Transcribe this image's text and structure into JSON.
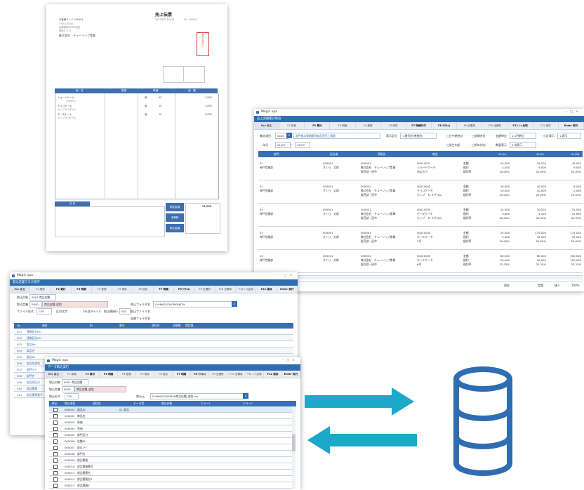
{
  "invoice": {
    "title": "売上伝票",
    "customer_code": "お客様コード 000001",
    "company": "株式会社　チューリップ食事",
    "seal_text": "株式会社チューリップ",
    "table_headers": [
      "品　名",
      "数量",
      "単価",
      "金　額"
    ],
    "lines": [
      {
        "name": "ショートケーキ",
        "sub": "(00001)",
        "qty": "45",
        "unit": "個",
        "amount": "7,000"
      },
      {
        "name": "チョコケーキ",
        "sub": "カップ 6.0グラム",
        "qty": "10",
        "unit": "個",
        "amount": "2,000"
      },
      {
        "name": "チーズケーキ",
        "sub": "カップ 6.0グラム",
        "qty": "10",
        "unit": "個",
        "amount": "2,000"
      }
    ],
    "total_label": "合 計",
    "total_value": "11,000",
    "side_labels": [
      "税抜金額",
      "消費税",
      "税込金額"
    ]
  },
  "detail_window": {
    "window_title": "Magic xpa",
    "app_title": "売上実績集計照会",
    "fkeys": [
      "Esc 戻る",
      "F1 検索",
      "F2 集計",
      "F3 明細",
      "F4 登録",
      "F5 削除",
      "F7 明細行付",
      "F8 ｸﾘｱ(s)",
      "F9 全選択",
      "F10 全解除",
      "F11 ｼｰﾄ反映",
      "F12 保存",
      "Enter 実行"
    ],
    "agg_label": "集計項目",
    "agg_value": "0016",
    "agg_desc": "部門拠点客顧客別商品別売上実績",
    "display_label": "表示区分",
    "display_value": "1:番号別(単独別)",
    "check1": "□日中期合計",
    "check2": "□前期合計",
    "unit_label": "金額単位",
    "unit_value": "1:1円単位",
    "small_label": "小計表示",
    "small_value": "1:表示",
    "period_label": "年月",
    "period_from": "21/04",
    "period_to": "22/03",
    "check3": "□発生内訳",
    "check4": "□前年対比",
    "qty_label": "数量表示",
    "qty_value": "0:非表示",
    "columns": [
      "部門",
      "担当者",
      "得意先",
      "商品",
      "",
      "21/04",
      "21/05",
      "21/06"
    ],
    "rows": [
      {
        "dept": "01",
        "dept2": "神戸営業部",
        "staff": "000001",
        "staff2": "さくら　太郎",
        "cust": "000001",
        "cust2": "株式会社　チューリップ食事",
        "cust3": "販売部・田中",
        "item": "00010001",
        "item2": "ショートケーキ",
        "item3": "あまおう",
        "k1": "金額",
        "k2": "粗利",
        "k3": "粗利率",
        "m1": [
          "20,000",
          "4,000",
          "20.00%"
        ],
        "m2": [
          "45,000",
          "9,000",
          "20.00%"
        ],
        "m3": [
          "45,000",
          "9,000",
          "20.00%"
        ]
      },
      {
        "dept": "01",
        "dept2": "神戸営業部",
        "staff": "000001",
        "staff2": "さくら　太郎",
        "cust": "000001",
        "cust2": "株式会社　チューリップ食事",
        "cust3": "販売部・田中",
        "item": "00010002",
        "item2": "チョコケーキ",
        "item3": "カップ　６.０グラム",
        "k1": "金額",
        "k2": "粗利",
        "k3": "粗利率",
        "m1": [
          "40,000",
          "10,000",
          "25.00%"
        ],
        "m2": [
          "40,000",
          "10,000",
          "25.00%"
        ],
        "m3": [
          "8,000",
          "2,000",
          "25.00%"
        ]
      },
      {
        "dept": "01",
        "dept2": "神戸営業部",
        "staff": "000001",
        "staff2": "さくら　太郎",
        "cust": "000001",
        "cust2": "株式会社　チューリップ食事",
        "cust3": "販売部・田中",
        "item": "00010003",
        "item2": "チーズケーキ",
        "item3": "カップ　６.０グラム",
        "k1": "金額",
        "k2": "粗利",
        "k3": "粗利率",
        "m1": [
          "24,500",
          "9,800",
          "40.00%"
        ],
        "m2": [
          "10,500",
          "4,200",
          "40.00%"
        ],
        "m3": [
          "31,500",
          "12,600",
          "40.00%"
        ]
      },
      {
        "dept": "01",
        "dept2": "神戸営業部",
        "staff": "000001",
        "staff2": "さくら　太郎",
        "cust": "000001",
        "cust2": "株式会社　チューリップ食事",
        "cust3": "販売部・田中",
        "item": "00010004",
        "item2": "ホールケーキ",
        "item3": "5号",
        "k1": "金額",
        "k2": "粗利",
        "k3": "粗利率",
        "m1": [
          "25,000",
          "5,000",
          "20.00%"
        ],
        "m2": [
          "175,000",
          "35,000",
          "20.00%"
        ],
        "m3": [
          "175,000",
          "35,000",
          "20.00%"
        ]
      },
      {
        "dept": "01",
        "dept2": "神戸営業部",
        "staff": "000001",
        "staff2": "さくら　太郎",
        "cust": "000001",
        "cust2": "株式会社　チューリップ食事",
        "cust3": "販売部・田中",
        "item": "00010005",
        "item2": "ホールケーキ",
        "item3": "6号",
        "k1": "金額",
        "k2": "粗利",
        "k3": "粗利率",
        "m1": [
          "60,000",
          "20,000",
          "33.33%"
        ],
        "m2": [
          "60,000",
          "20,000",
          "33.33%"
        ],
        "m3": [
          "300,000",
          "100,000",
          "33.33%"
        ]
      }
    ],
    "status": [
      "固金",
      "定権",
      "挿入",
      "100%"
    ]
  },
  "master_window": {
    "window_title": "Magic xpa",
    "app_title": "取込定義マスタ保守",
    "fkeys": [
      "Esc 戻る",
      "F1 検索",
      "F2 集計",
      "F3 明細",
      "F4 登録",
      "F5 削除",
      "F6 追加",
      "F7 明細",
      "F8 ｸﾘｱ(s)",
      "F9 全選択",
      "F10 全解除",
      "F11 ｼｰﾄ反映",
      "F12 保存",
      "Enter 実行"
    ],
    "target_label": "取込対象",
    "target_value": "0001 商品店舗",
    "def_label": "取込定義",
    "def_code": "0000",
    "def_name": "商品店舗_追加",
    "folder_label": "取込フォルダ名",
    "folder_value": "D:¥MAGICWORK¥WTH",
    "file_label": "ファイル形式",
    "file_value": "CSV",
    "sep_label": "区切文字",
    "title_label": "1行目タイトル",
    "start_label": "取込開始行",
    "start_value": "002",
    "file_name_label": "取込ファイル名",
    "temp_label": "退避フォルダ名",
    "cols": [
      "No",
      "項目",
      "桁",
      "書式",
      "項目名",
      "初期値",
      "固定値"
    ],
    "rows": [
      "001",
      "002",
      "003",
      "004",
      "005",
      "006",
      "007",
      "008",
      "009",
      "010",
      "011"
    ],
    "row_labels": [
      "連携区分RO",
      "連携区分RO",
      "製品No",
      "製品名",
      "製品ID",
      "部品用途別",
      "部門ｺｰﾄﾞ",
      "部門名",
      "部品名区分",
      "部品関連",
      "部品関連番号"
    ]
  },
  "import_window": {
    "window_title": "Magic xpa",
    "app_title": "データ取込実行",
    "fkeys": [
      "Esc 戻る",
      "F1 検索",
      "F2 集計",
      "F3 明細",
      "F4 登録",
      "F5 削除",
      "F6 追加",
      "F7 明細",
      "F8 ｸﾘｱ(s)",
      "F9 全選択",
      "F10 全解除",
      "F11 ｼｰﾄ反映",
      "F12 保存",
      "Enter 実行"
    ],
    "target_label": "取込対象",
    "target_value": "0001 商品店舗",
    "def_label": "取込定義",
    "def_code": "0000",
    "def_name": "商品店舗_追加",
    "folder_label": "取込形式",
    "folder_value": "CSV",
    "file_label": "取込元",
    "file_value": "D:¥MAGICWORK¥商品店舗_追加.csv",
    "cols": [
      "取込",
      "取込項目",
      "項目名",
      "データ型",
      "取込対象",
      "エラー1",
      "エラー2"
    ],
    "items": [
      "商品ID",
      "商品名",
      "原価",
      "売価",
      "部門区分",
      "店舗ID",
      "取込ｺｰﾄﾞ",
      "部門名",
      "部品関連",
      "部品関連番号",
      "部品関連名",
      "部品関連名2",
      "部品関連3"
    ],
    "first_value": "01 商品"
  },
  "colors": {
    "accent": "#2f6db2",
    "arrow": "#1ba8c9",
    "db": "#2f6db2",
    "stamp": "#d23c3c"
  },
  "icons": [
    "database-icon",
    "arrow-right-icon",
    "arrow-left-icon",
    "search-icon",
    "window-icon"
  ]
}
